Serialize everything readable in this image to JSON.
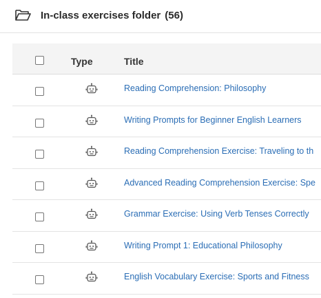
{
  "header": {
    "folder_icon": "folder-open-icon",
    "title": "In-class exercises folder",
    "count": "(56)"
  },
  "table": {
    "columns": {
      "type": "Type",
      "title": "Title"
    },
    "row_icon": "robot-icon",
    "rows": [
      {
        "title": "Reading Comprehension: Philosophy"
      },
      {
        "title": "Writing Prompts for Beginner English Learners"
      },
      {
        "title": "Reading Comprehension Exercise: Traveling to th"
      },
      {
        "title": "Advanced Reading Comprehension Exercise: Spe"
      },
      {
        "title": "Grammar Exercise: Using Verb Tenses Correctly"
      },
      {
        "title": "Writing Prompt 1: Educational Philosophy"
      },
      {
        "title": "English Vocabulary Exercise: Sports and Fitness"
      }
    ]
  },
  "colors": {
    "link": "#2a6db5",
    "header_bg": "#f4f4f4"
  }
}
